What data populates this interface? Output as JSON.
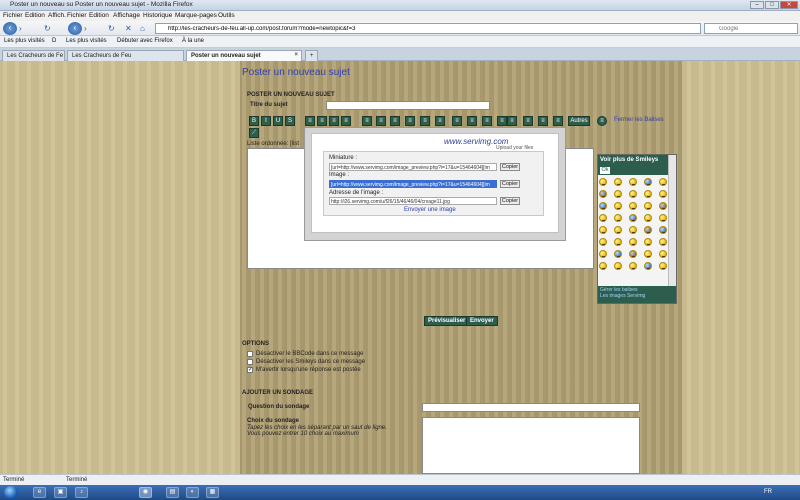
{
  "window": {
    "title_left": "Poster un nouveau su",
    "title_right": "Poster un nouveau sujet - Mozilla Firefox",
    "btn_min": "–",
    "btn_max": "□",
    "btn_close": "✕"
  },
  "menu": {
    "left": [
      "Fichier",
      "Edition",
      "Affich."
    ],
    "right": [
      "Fichier",
      "Edition",
      "Affichage",
      "Historique",
      "Marque-pages",
      "Outils"
    ]
  },
  "nav": {
    "url": "http://les-cracheurs-de-feu.all-up.com/post.forum?mode=newtopic&f=3",
    "search_placeholder": "Google"
  },
  "bookmarks": {
    "items": [
      "Les plus visités",
      "D",
      "Les plus visités",
      "Débuter avec Firefox",
      "À la une"
    ]
  },
  "tabs": [
    {
      "label": "Les Cracheurs de Fe",
      "active": false
    },
    {
      "label": "Les Cracheurs de Feu",
      "active": false
    },
    {
      "label": "Poster un nouveau sujet",
      "active": true
    }
  ],
  "new_tab_label": "+",
  "page": {
    "heading": "Poster un nouveau sujet",
    "section_new_topic": "POSTER UN NOUVEAU SUJET",
    "subject_label": "Titre du sujet",
    "subject_value": "",
    "toolbar": {
      "buttons": [
        "B",
        "I",
        "U",
        "S",
        "≡",
        "≡",
        "≡",
        "≡",
        "≡",
        "≡",
        "≡",
        "≡",
        "≡",
        "≡",
        "≡",
        "≡",
        "≡",
        "≡",
        "≡",
        "≡",
        "≡",
        "≡",
        "≡"
      ],
      "others_label": "Autres",
      "close_tags_link": "Fermer les Balises",
      "second_row_button": "⟋"
    },
    "ordered_list_hint": "Liste ordonnée: [list",
    "message_value": "",
    "preview_button": "Prévisualiser",
    "send_button": "Envoyer",
    "options_title": "OPTIONS",
    "options": [
      {
        "label": "Désactiver le BBCode dans ce message",
        "checked": false
      },
      {
        "label": "Désactiver les Smileys dans ce message",
        "checked": false
      },
      {
        "label": "M'avertir lorsqu'une réponse est postée",
        "checked": true
      }
    ],
    "poll_title": "AJOUTER UN SONDAGE",
    "poll_question_label": "Question du sondage",
    "poll_question_value": "",
    "poll_choices_label": "Choix du sondage",
    "poll_choices_help_1": "Tapez les choix en les séparant par un saut de ligne.",
    "poll_choices_help_2": "Vous pouvez entrer 10 choix au maximum",
    "poll_choices_value": ""
  },
  "popup": {
    "logo": "www.servimg.com",
    "tagline": "Upload your files",
    "miniature_label": "Miniature :",
    "miniature_value": "[url=http://www.servimg.com/image_preview.php?i=17&u=15464604][im",
    "image_label": "Image :",
    "image_value": "[url=http://www.servimg.com/image_preview.php?i=17&u=15464604][im",
    "address_label": "Adresse de l'image :",
    "address_value": "http://i26.servimg.com/u/f26/15/46/46/04/crxage11.jpg",
    "copy_label": "Copier",
    "send_image_link": "Envoyer une image"
  },
  "smileys": {
    "header": "Voir plus de Smileys",
    "ok": "Ok",
    "footer_1": "Gérer les balises",
    "footer_2": "Les images Servimg"
  },
  "status": {
    "left": "Terminé",
    "right": "Terminé"
  },
  "taskbar": {
    "icons": [
      "e",
      "▣",
      "♪",
      "◉",
      "▤",
      "◐",
      "▦"
    ],
    "lang": "FR",
    "time": "",
    "date": ""
  }
}
